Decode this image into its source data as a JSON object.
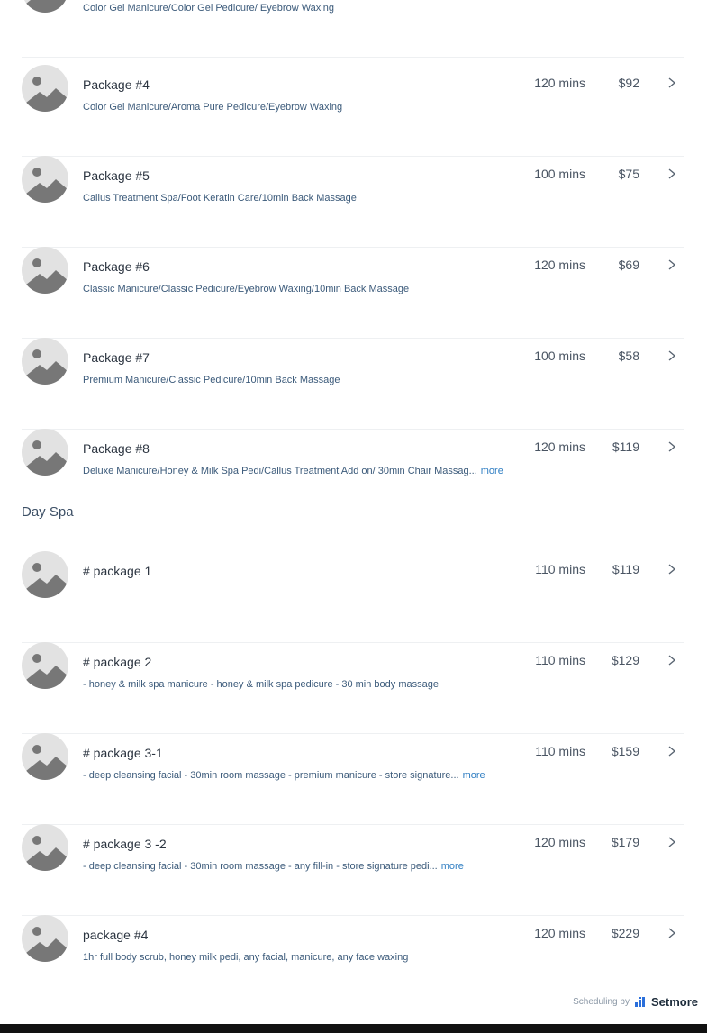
{
  "services": [
    {
      "name": "",
      "description": "Color Gel Manicure/Color Gel Pedicure/ Eyebrow Waxing",
      "duration": "",
      "price": "",
      "more": ""
    },
    {
      "name": "Package #4",
      "description": "Color Gel Manicure/Aroma Pure Pedicure/Eyebrow Waxing",
      "duration": "120 mins",
      "price": "$92",
      "more": ""
    },
    {
      "name": "Package #5",
      "description": "Callus Treatment Spa/Foot Keratin Care/10min Back Massage",
      "duration": "100 mins",
      "price": "$75",
      "more": ""
    },
    {
      "name": "Package #6",
      "description": "Classic Manicure/Classic Pedicure/Eyebrow Waxing/10min Back Massage",
      "duration": "120 mins",
      "price": "$69",
      "more": ""
    },
    {
      "name": "Package #7",
      "description": "Premium Manicure/Classic Pedicure/10min Back Massage",
      "duration": "100 mins",
      "price": "$58",
      "more": ""
    },
    {
      "name": "Package #8",
      "description": "Deluxe Manicure/Honey & Milk Spa Pedi/Callus Treatment Add on/ 30min Chair Massag...",
      "duration": "120 mins",
      "price": "$119",
      "more": "more"
    }
  ],
  "day_spa": {
    "heading": "Day Spa",
    "services": [
      {
        "name": "# package 1",
        "description": "",
        "duration": "110 mins",
        "price": "$119",
        "more": ""
      },
      {
        "name": "# package 2",
        "description": "- honey & milk spa manicure - honey & milk spa pedicure - 30 min body massage",
        "duration": "110 mins",
        "price": "$129",
        "more": ""
      },
      {
        "name": "# package 3-1",
        "description": "- deep cleansing facial - 30min room massage - premium manicure - store signature...",
        "duration": "110 mins",
        "price": "$159",
        "more": "more"
      },
      {
        "name": "# package 3 -2",
        "description": "- deep cleansing facial - 30min room massage - any fill-in - store signature pedi...",
        "duration": "120 mins",
        "price": "$179",
        "more": "more"
      },
      {
        "name": "package #4",
        "description": "1hr full body scrub, honey milk pedi, any facial, manicure, any face waxing",
        "duration": "120 mins",
        "price": "$229",
        "more": ""
      }
    ]
  },
  "footer": {
    "scheduling_by": "Scheduling by",
    "brand": "Setmore"
  },
  "colors": {
    "more_link": "#2e7dc2",
    "brand_icon": "#2a6fdb"
  }
}
